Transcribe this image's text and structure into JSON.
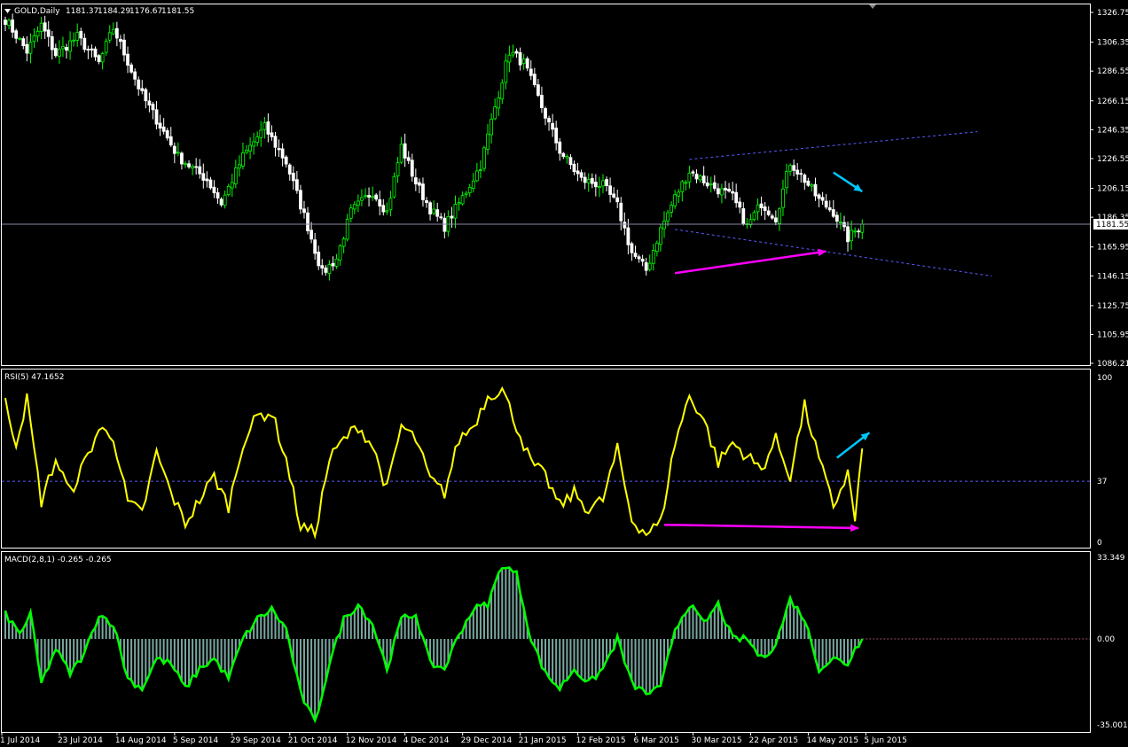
{
  "chart_data": [
    {
      "type": "candlestick",
      "header": {
        "symbol": "GOLD,Daily",
        "open": "1181.37",
        "high": "1184.29",
        "low": "1176.67",
        "close": "1181.55"
      },
      "current_price_label": "1181.55",
      "current_price": 1181.55,
      "ylim": [
        1086.21,
        1336.0
      ],
      "y_ticks": [
        "1326.75",
        "1306.35",
        "1286.55",
        "1266.15",
        "1246.35",
        "1226.55",
        "1206.15",
        "1186.35",
        "1165.95",
        "1146.15",
        "1125.75",
        "1105.95",
        "1086.21"
      ],
      "y_tick_values": [
        1326.75,
        1306.35,
        1286.55,
        1266.15,
        1246.35,
        1226.55,
        1206.15,
        1186.35,
        1165.95,
        1146.15,
        1125.75,
        1105.95,
        1086.21
      ],
      "anchors": [
        {
          "i": 0,
          "p": 1322
        },
        {
          "i": 6,
          "p": 1300
        },
        {
          "i": 10,
          "p": 1318
        },
        {
          "i": 14,
          "p": 1298
        },
        {
          "i": 20,
          "p": 1310
        },
        {
          "i": 26,
          "p": 1292
        },
        {
          "i": 30,
          "p": 1316
        },
        {
          "i": 38,
          "p": 1270
        },
        {
          "i": 48,
          "p": 1228
        },
        {
          "i": 56,
          "p": 1212
        },
        {
          "i": 60,
          "p": 1196
        },
        {
          "i": 66,
          "p": 1228
        },
        {
          "i": 72,
          "p": 1248
        },
        {
          "i": 78,
          "p": 1224
        },
        {
          "i": 84,
          "p": 1180
        },
        {
          "i": 88,
          "p": 1148
        },
        {
          "i": 92,
          "p": 1158
        },
        {
          "i": 96,
          "p": 1190
        },
        {
          "i": 102,
          "p": 1204
        },
        {
          "i": 106,
          "p": 1190
        },
        {
          "i": 110,
          "p": 1235
        },
        {
          "i": 114,
          "p": 1210
        },
        {
          "i": 118,
          "p": 1192
        },
        {
          "i": 122,
          "p": 1180
        },
        {
          "i": 127,
          "p": 1200
        },
        {
          "i": 132,
          "p": 1222
        },
        {
          "i": 136,
          "p": 1262
        },
        {
          "i": 140,
          "p": 1300
        },
        {
          "i": 144,
          "p": 1292
        },
        {
          "i": 148,
          "p": 1268
        },
        {
          "i": 154,
          "p": 1232
        },
        {
          "i": 160,
          "p": 1212
        },
        {
          "i": 166,
          "p": 1208
        },
        {
          "i": 170,
          "p": 1194
        },
        {
          "i": 174,
          "p": 1162
        },
        {
          "i": 178,
          "p": 1150
        },
        {
          "i": 182,
          "p": 1178
        },
        {
          "i": 186,
          "p": 1200
        },
        {
          "i": 190,
          "p": 1218
        },
        {
          "i": 196,
          "p": 1208
        },
        {
          "i": 202,
          "p": 1200
        },
        {
          "i": 206,
          "p": 1180
        },
        {
          "i": 210,
          "p": 1196
        },
        {
          "i": 214,
          "p": 1186
        },
        {
          "i": 218,
          "p": 1224
        },
        {
          "i": 222,
          "p": 1212
        },
        {
          "i": 226,
          "p": 1198
        },
        {
          "i": 230,
          "p": 1190
        },
        {
          "i": 234,
          "p": 1172
        },
        {
          "i": 238,
          "p": 1181.5
        }
      ],
      "bar_count": 239,
      "trendlines": [
        {
          "from": {
            "i": 190,
            "p": 1226
          },
          "to": {
            "i": 270,
            "p": 1245
          }
        },
        {
          "from": {
            "i": 186,
            "p": 1178
          },
          "to": {
            "i": 274,
            "p": 1146
          }
        }
      ],
      "arrows": [
        {
          "color": "#00c8ff",
          "from": {
            "i": 230,
            "p": 1217
          },
          "to": {
            "i": 238,
            "p": 1204
          }
        },
        {
          "color": "#ff00ff",
          "from": {
            "i": 186,
            "p": 1148
          },
          "to": {
            "i": 228,
            "p": 1163
          }
        }
      ],
      "bull_color": "#00ff00",
      "bear_color": "#ffffff"
    },
    {
      "type": "line",
      "header": "RSI(5) 47.1652",
      "ylim": [
        0,
        100
      ],
      "y_ticks": [
        "100",
        "37",
        "0"
      ],
      "y_tick_values": [
        100,
        37,
        0
      ],
      "level": 37,
      "line_color": "#ffff00",
      "values_anchor": [
        {
          "i": 0,
          "v": 84
        },
        {
          "i": 3,
          "v": 60
        },
        {
          "i": 6,
          "v": 86
        },
        {
          "i": 10,
          "v": 25
        },
        {
          "i": 14,
          "v": 50
        },
        {
          "i": 18,
          "v": 30
        },
        {
          "i": 22,
          "v": 48
        },
        {
          "i": 26,
          "v": 68
        },
        {
          "i": 30,
          "v": 64
        },
        {
          "i": 34,
          "v": 24
        },
        {
          "i": 38,
          "v": 18
        },
        {
          "i": 42,
          "v": 54
        },
        {
          "i": 46,
          "v": 30
        },
        {
          "i": 50,
          "v": 12
        },
        {
          "i": 54,
          "v": 26
        },
        {
          "i": 58,
          "v": 40
        },
        {
          "i": 62,
          "v": 22
        },
        {
          "i": 66,
          "v": 60
        },
        {
          "i": 70,
          "v": 76
        },
        {
          "i": 74,
          "v": 78
        },
        {
          "i": 78,
          "v": 50
        },
        {
          "i": 82,
          "v": 10
        },
        {
          "i": 86,
          "v": 6
        },
        {
          "i": 90,
          "v": 50
        },
        {
          "i": 94,
          "v": 62
        },
        {
          "i": 98,
          "v": 70
        },
        {
          "i": 102,
          "v": 58
        },
        {
          "i": 106,
          "v": 32
        },
        {
          "i": 110,
          "v": 70
        },
        {
          "i": 114,
          "v": 62
        },
        {
          "i": 118,
          "v": 38
        },
        {
          "i": 122,
          "v": 30
        },
        {
          "i": 126,
          "v": 62
        },
        {
          "i": 130,
          "v": 70
        },
        {
          "i": 134,
          "v": 88
        },
        {
          "i": 138,
          "v": 92
        },
        {
          "i": 142,
          "v": 70
        },
        {
          "i": 146,
          "v": 48
        },
        {
          "i": 150,
          "v": 40
        },
        {
          "i": 154,
          "v": 22
        },
        {
          "i": 158,
          "v": 30
        },
        {
          "i": 162,
          "v": 20
        },
        {
          "i": 166,
          "v": 26
        },
        {
          "i": 170,
          "v": 56
        },
        {
          "i": 174,
          "v": 14
        },
        {
          "i": 178,
          "v": 6
        },
        {
          "i": 182,
          "v": 12
        },
        {
          "i": 186,
          "v": 60
        },
        {
          "i": 190,
          "v": 88
        },
        {
          "i": 194,
          "v": 74
        },
        {
          "i": 198,
          "v": 48
        },
        {
          "i": 202,
          "v": 60
        },
        {
          "i": 206,
          "v": 52
        },
        {
          "i": 210,
          "v": 44
        },
        {
          "i": 214,
          "v": 62
        },
        {
          "i": 218,
          "v": 40
        },
        {
          "i": 222,
          "v": 82
        },
        {
          "i": 226,
          "v": 50
        },
        {
          "i": 230,
          "v": 22
        },
        {
          "i": 234,
          "v": 42
        },
        {
          "i": 236,
          "v": 14
        },
        {
          "i": 238,
          "v": 56
        },
        {
          "i": 239,
          "v": 48
        }
      ],
      "arrows": [
        {
          "color": "#00c8ff",
          "from": {
            "i": 231,
            "v": 51
          },
          "to": {
            "i": 240,
            "v": 66
          }
        },
        {
          "color": "#ff00ff",
          "from": {
            "i": 183,
            "v": 11
          },
          "to": {
            "i": 237,
            "v": 9
          }
        }
      ]
    },
    {
      "type": "bar",
      "header": "MACD(2,8,1) -0.265 -0.265",
      "ylim": [
        -35.001,
        33.349
      ],
      "y_ticks": [
        "33.349",
        "0.00",
        "-35.001"
      ],
      "y_tick_values": [
        33.349,
        0,
        -35.001
      ],
      "zero_level_label": "0.00",
      "line_color": "#00ff00",
      "hist_color": "#7aa6a0",
      "values_anchor": [
        {
          "i": 0,
          "v": 10
        },
        {
          "i": 4,
          "v": 2
        },
        {
          "i": 7,
          "v": 10
        },
        {
          "i": 10,
          "v": -18
        },
        {
          "i": 14,
          "v": -4
        },
        {
          "i": 18,
          "v": -14
        },
        {
          "i": 22,
          "v": -6
        },
        {
          "i": 26,
          "v": 10
        },
        {
          "i": 30,
          "v": 6
        },
        {
          "i": 34,
          "v": -16
        },
        {
          "i": 38,
          "v": -20
        },
        {
          "i": 42,
          "v": -8
        },
        {
          "i": 46,
          "v": -10
        },
        {
          "i": 50,
          "v": -20
        },
        {
          "i": 54,
          "v": -12
        },
        {
          "i": 58,
          "v": -8
        },
        {
          "i": 62,
          "v": -16
        },
        {
          "i": 66,
          "v": 0
        },
        {
          "i": 70,
          "v": 8
        },
        {
          "i": 74,
          "v": 12
        },
        {
          "i": 78,
          "v": 4
        },
        {
          "i": 82,
          "v": -22
        },
        {
          "i": 86,
          "v": -34
        },
        {
          "i": 90,
          "v": -10
        },
        {
          "i": 94,
          "v": 8
        },
        {
          "i": 98,
          "v": 14
        },
        {
          "i": 102,
          "v": 6
        },
        {
          "i": 106,
          "v": -12
        },
        {
          "i": 110,
          "v": 8
        },
        {
          "i": 114,
          "v": 10
        },
        {
          "i": 118,
          "v": -10
        },
        {
          "i": 122,
          "v": -12
        },
        {
          "i": 126,
          "v": 2
        },
        {
          "i": 130,
          "v": 12
        },
        {
          "i": 134,
          "v": 14
        },
        {
          "i": 138,
          "v": 30
        },
        {
          "i": 142,
          "v": 26
        },
        {
          "i": 146,
          "v": 0
        },
        {
          "i": 150,
          "v": -14
        },
        {
          "i": 154,
          "v": -20
        },
        {
          "i": 158,
          "v": -12
        },
        {
          "i": 162,
          "v": -18
        },
        {
          "i": 166,
          "v": -12
        },
        {
          "i": 170,
          "v": 0
        },
        {
          "i": 174,
          "v": -18
        },
        {
          "i": 178,
          "v": -22
        },
        {
          "i": 182,
          "v": -20
        },
        {
          "i": 186,
          "v": 4
        },
        {
          "i": 190,
          "v": 14
        },
        {
          "i": 194,
          "v": 6
        },
        {
          "i": 198,
          "v": 14
        },
        {
          "i": 202,
          "v": 0
        },
        {
          "i": 206,
          "v": 0
        },
        {
          "i": 210,
          "v": -8
        },
        {
          "i": 214,
          "v": -2
        },
        {
          "i": 218,
          "v": 16
        },
        {
          "i": 222,
          "v": 8
        },
        {
          "i": 226,
          "v": -12
        },
        {
          "i": 230,
          "v": -8
        },
        {
          "i": 234,
          "v": -10
        },
        {
          "i": 236,
          "v": -4
        },
        {
          "i": 238,
          "v": 0
        },
        {
          "i": 239,
          "v": -0.265
        }
      ]
    }
  ],
  "x_axis": {
    "labels": [
      "1 Jul 2014",
      "23 Jul 2014",
      "14 Aug 2014",
      "5 Sep 2014",
      "29 Sep 2014",
      "21 Oct 2014",
      "12 Nov 2014",
      "4 Dec 2014",
      "29 Dec 2014",
      "21 Jan 2015",
      "12 Feb 2015",
      "6 Mar 2015",
      "30 Mar 2015",
      "22 Apr 2015",
      "14 May 2015",
      "5 Jun 2015"
    ],
    "label_bar_index": [
      0,
      16,
      32,
      48,
      64,
      80,
      96,
      112,
      128,
      144,
      160,
      176,
      192,
      208,
      224,
      240
    ]
  }
}
